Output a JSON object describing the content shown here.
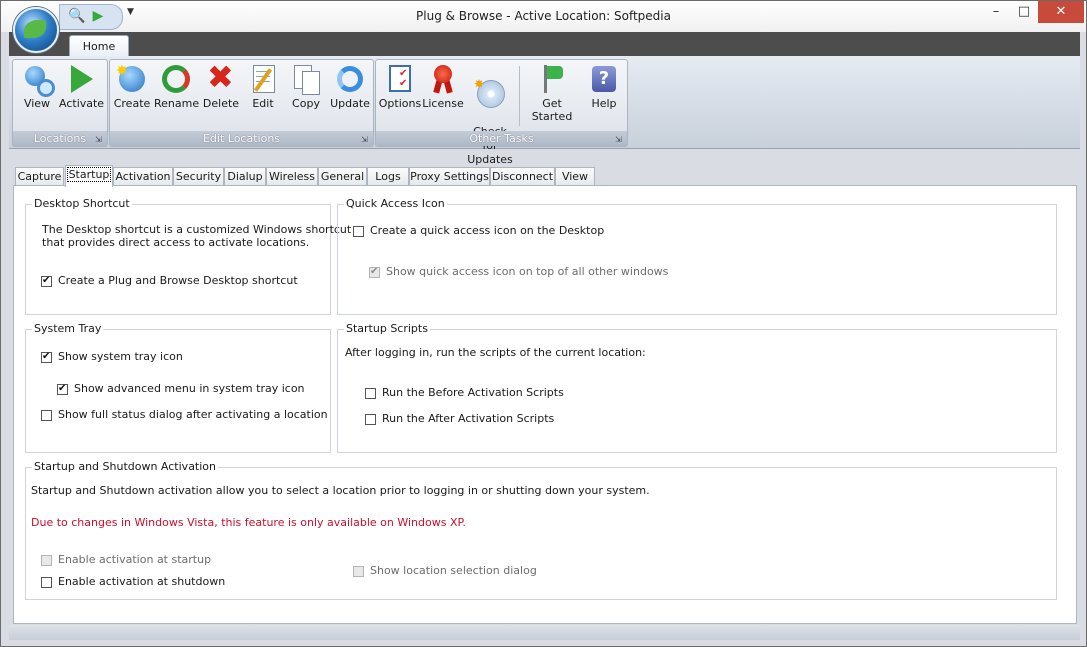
{
  "window": {
    "title": "Plug & Browse - Active Location: Softpedia",
    "minimize": "–",
    "maximize": "□",
    "close": "✕"
  },
  "ribbon_tabs": [
    "Home"
  ],
  "ribbon": {
    "groups": [
      {
        "label": "Locations",
        "buttons": [
          "View",
          "Activate"
        ]
      },
      {
        "label": "Edit Locations",
        "buttons": [
          "Create",
          "Rename",
          "Delete",
          "Edit",
          "Copy",
          "Update"
        ]
      },
      {
        "label": "Other Tasks",
        "buttons": [
          "Options",
          "License",
          "Check for\nUpdates",
          "Get Started",
          "Help"
        ]
      }
    ]
  },
  "tabs": [
    "Capture",
    "Startup",
    "Activation",
    "Security",
    "Dialup",
    "Wireless",
    "General",
    "Logs",
    "Proxy Settings",
    "Disconnect",
    "View"
  ],
  "active_tab": "Startup",
  "desktop_shortcut": {
    "title": "Desktop Shortcut",
    "desc_line1": "The Desktop shortcut is a customized Windows shortcut",
    "desc_line2": "that provides direct access to activate locations.",
    "create_label": "Create a Plug and Browse Desktop shortcut",
    "create_checked": true
  },
  "quick_access": {
    "title": "Quick Access Icon",
    "create_label": "Create a quick access icon on the Desktop",
    "create_checked": false,
    "ontop_label": "Show quick access icon  on top of all other windows",
    "ontop_checked": true,
    "ontop_disabled": true
  },
  "system_tray": {
    "title": "System Tray",
    "show_icon_label": "Show system tray icon",
    "show_icon_checked": true,
    "advanced_label": "Show advanced menu in system tray icon",
    "advanced_checked": true,
    "full_status_label": "Show full status dialog after activating a location",
    "full_status_checked": false
  },
  "startup_scripts": {
    "title": "Startup Scripts",
    "desc": "After logging in, run the scripts of the current location:",
    "before_label": "Run the Before Activation Scripts",
    "before_checked": false,
    "after_label": "Run the After Activation Scripts",
    "after_checked": false
  },
  "startup_shutdown": {
    "title": "Startup and Shutdown Activation",
    "desc": "Startup and Shutdown activation allow you to select a location prior to logging in or shutting down your system.",
    "warning": "Due to changes in Windows Vista, this feature is only available on Windows XP.",
    "startup_label": "Enable activation at startup",
    "shutdown_label": "Enable activation at shutdown",
    "selection_label": "Show location selection dialog"
  },
  "colors": {
    "warning": "#c8102e",
    "close_button": "#c74a3a",
    "ribbon_dark": "#4d4d4d"
  }
}
